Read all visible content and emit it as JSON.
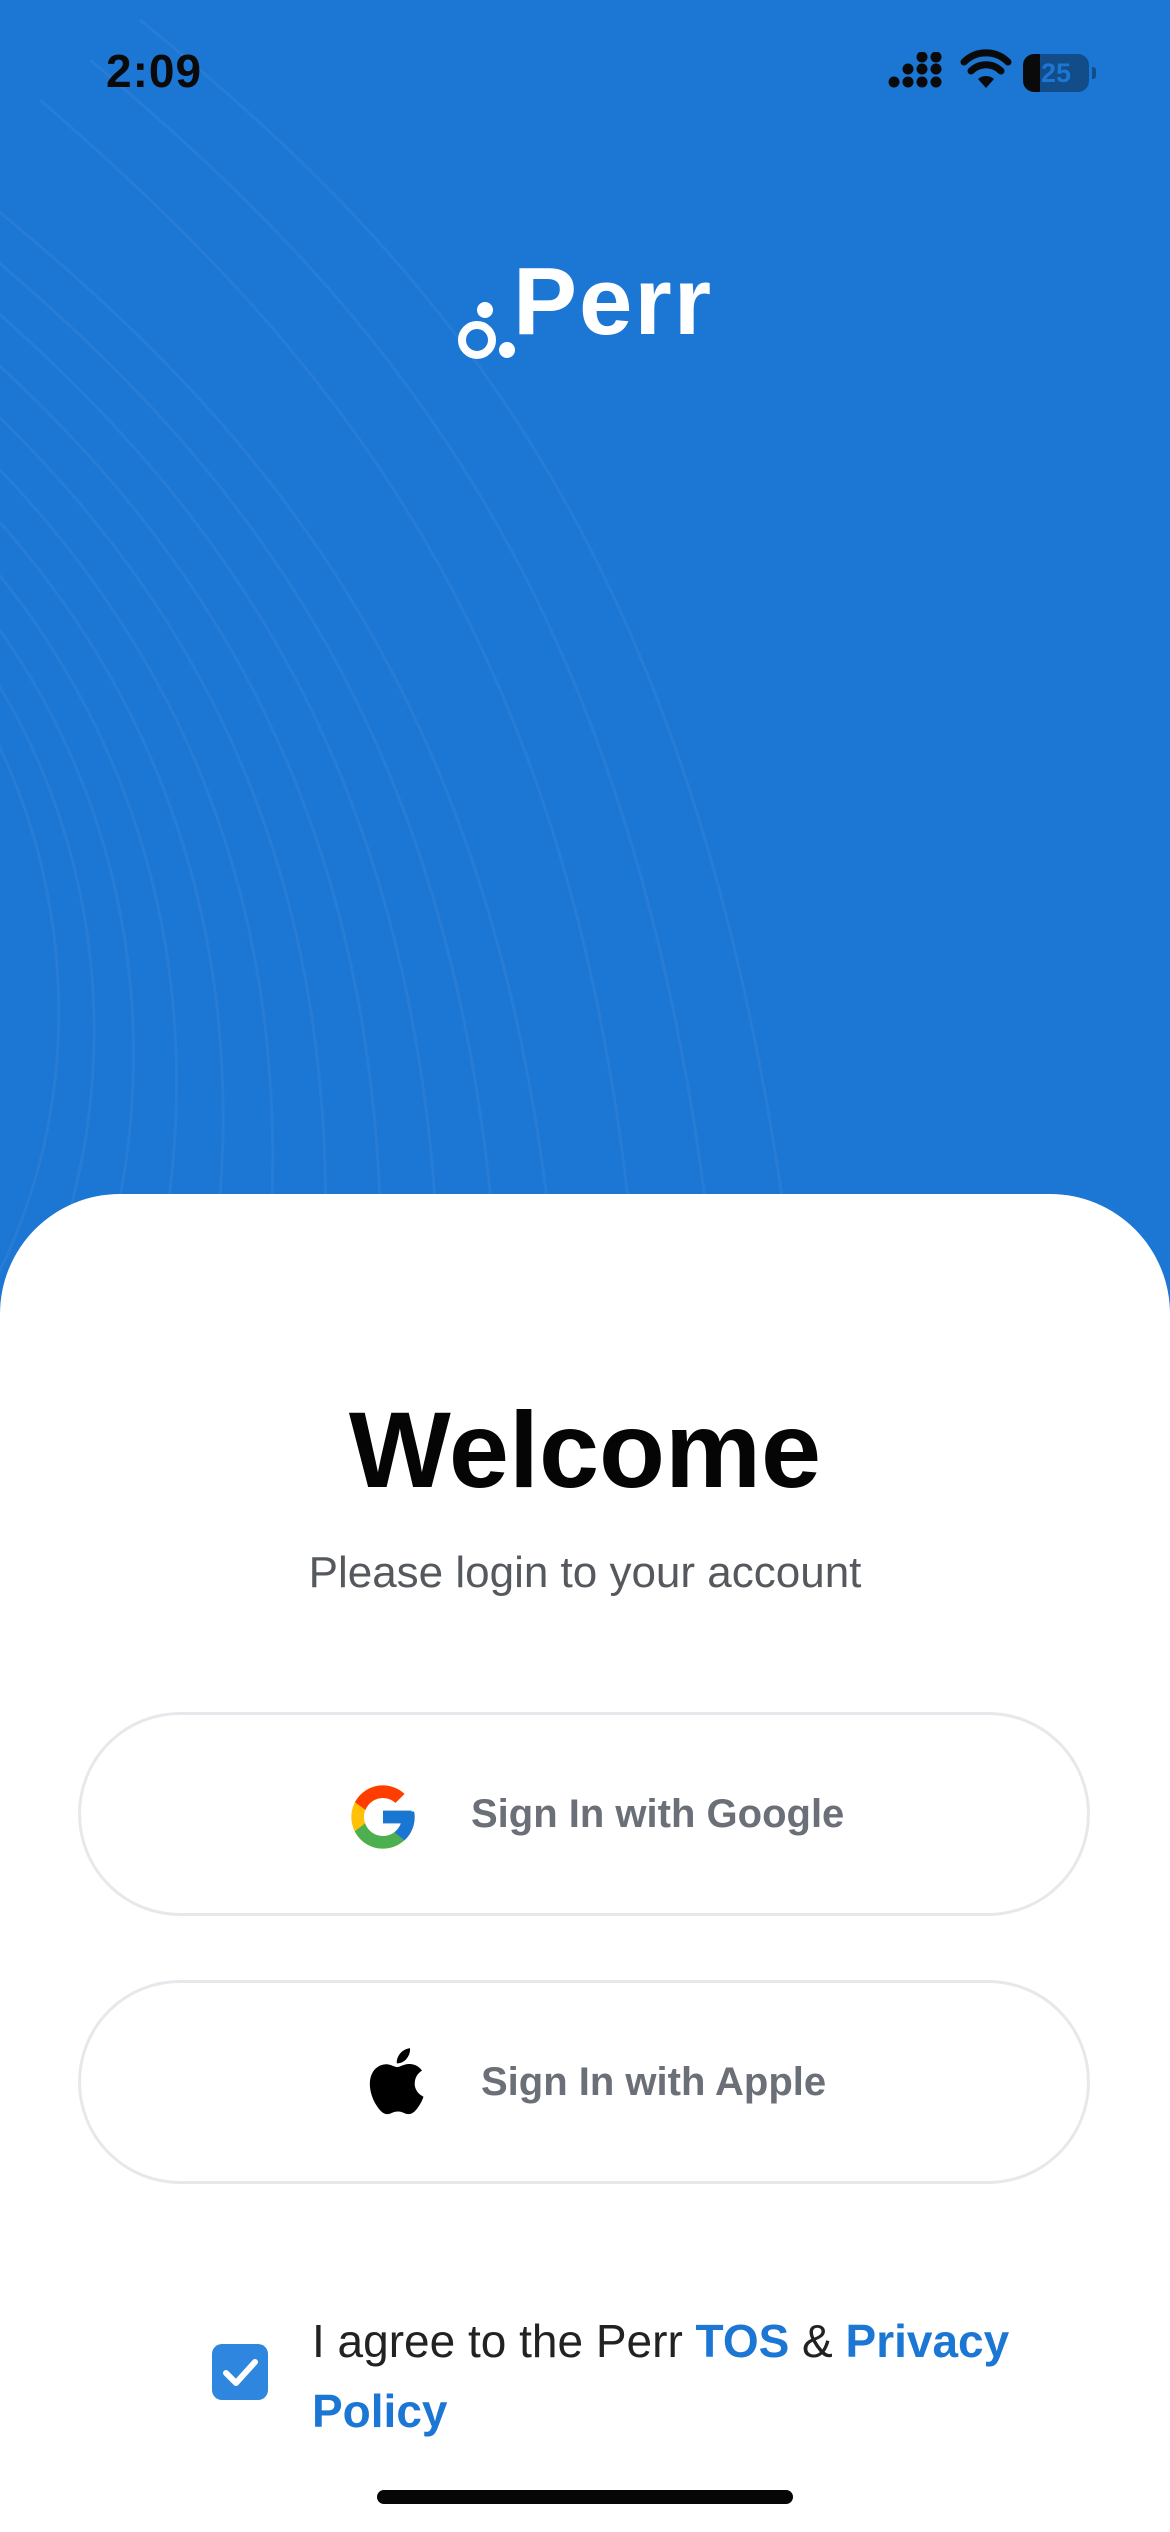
{
  "status_bar": {
    "time": "2:09",
    "battery_level": "25",
    "icons": [
      "signal-icon",
      "wifi-icon",
      "battery-icon"
    ]
  },
  "brand": {
    "name": "Perr",
    "color": "#1c76d3"
  },
  "welcome": {
    "title": "Welcome",
    "subtitle": "Please login to your account"
  },
  "buttons": {
    "google": {
      "label": "Sign In with Google",
      "icon": "google-icon"
    },
    "apple": {
      "label": "Sign In with Apple",
      "icon": "apple-icon"
    }
  },
  "agreement": {
    "checked": true,
    "prefix": "I agree to the Perr ",
    "tos": "TOS",
    "separator": " & ",
    "privacy": "Privacy Policy"
  }
}
